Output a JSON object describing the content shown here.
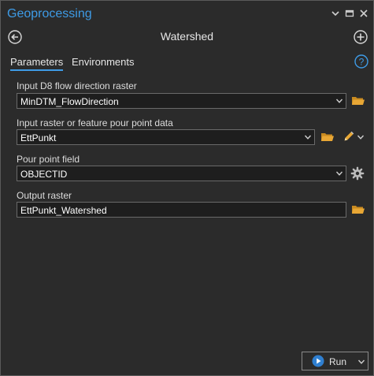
{
  "pane": {
    "title": "Geoprocessing"
  },
  "tool": {
    "title": "Watershed"
  },
  "tabs": [
    {
      "label": "Parameters",
      "active": true
    },
    {
      "label": "Environments",
      "active": false
    }
  ],
  "params": {
    "flow_direction": {
      "label": "Input D8 flow direction raster",
      "value": "MinDTM_FlowDirection"
    },
    "pour_point": {
      "label": "Input raster or feature pour point data",
      "value": "EttPunkt"
    },
    "pour_field": {
      "label": "Pour point field",
      "value": "OBJECTID"
    },
    "output": {
      "label": "Output raster",
      "value": "EttPunkt_Watershed"
    }
  },
  "run": {
    "label": "Run"
  },
  "colors": {
    "accent": "#3e9be6",
    "folder": "#e8a735",
    "background": "#2b2b2b",
    "field": "#1e1e1e"
  },
  "icons": [
    "chevron-down-icon",
    "restore-icon",
    "close-icon",
    "back-icon",
    "add-icon",
    "help-icon",
    "folder-icon",
    "pencil-icon",
    "gear-icon",
    "play-icon"
  ]
}
